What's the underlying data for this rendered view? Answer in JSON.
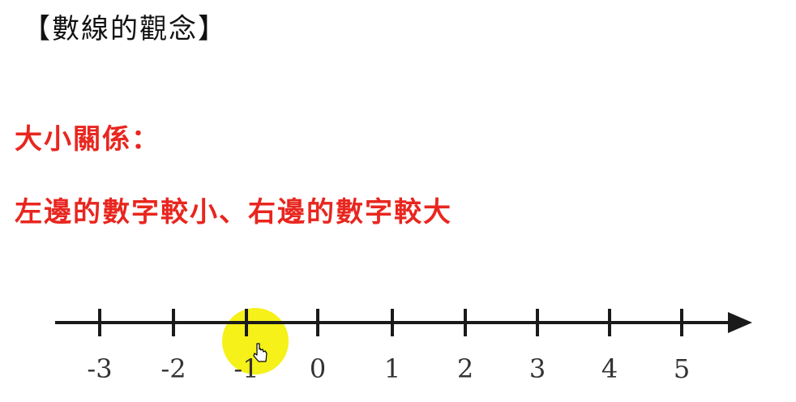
{
  "title": "【數線的觀念】",
  "heading": "大小關係：",
  "rule": "左邊的數字較小、右邊的數字較大",
  "number_line": {
    "labels": [
      "-3",
      "-2",
      "-1",
      "0",
      "1",
      "2",
      "3",
      "4",
      "5"
    ],
    "highlighted_label": "-1",
    "highlight_color": "#f4f000",
    "line_color": "#1a1a1a",
    "text_color": "#e8261f"
  }
}
